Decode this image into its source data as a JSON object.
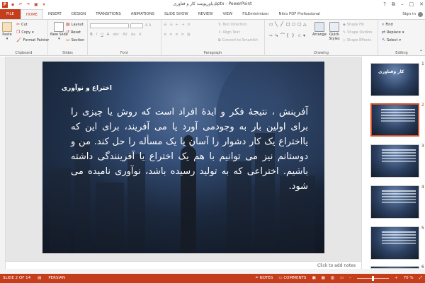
{
  "window": {
    "title": "پاورپوینت کار و فناوری.pptx - PowerPoint",
    "help": "?",
    "minimize": "–",
    "restore": "□",
    "close": "✕",
    "sign_in": "Sign in"
  },
  "tabs": [
    "FILE",
    "HOME",
    "INSERT",
    "DESIGN",
    "TRANSITIONS",
    "ANIMATIONS",
    "SLIDE SHOW",
    "REVIEW",
    "VIEW",
    "FILEminimizer",
    "Nitro PDF Professional"
  ],
  "active_tab": "HOME",
  "ribbon": {
    "clipboard": {
      "label": "Clipboard",
      "paste": "Paste",
      "cut": "Cut",
      "copy": "Copy",
      "format_painter": "Format Painter"
    },
    "slides": {
      "label": "Slides",
      "new_slide": "New Slide",
      "layout": "Layout",
      "reset": "Reset",
      "section": "Section"
    },
    "font": {
      "label": "Font",
      "font_name": "",
      "font_size": ""
    },
    "paragraph": {
      "label": "Paragraph",
      "text_direction": "Text Direction",
      "align_text": "Align Text",
      "convert_smartart": "Convert to SmartArt"
    },
    "drawing": {
      "label": "Drawing",
      "arrange": "Arrange",
      "quick_styles": "Quick Styles",
      "shape_fill": "Shape Fill",
      "shape_outline": "Shape Outline",
      "shape_effects": "Shape Effects"
    },
    "editing": {
      "label": "Editing",
      "find": "Find",
      "replace": "Replace",
      "select": "Select"
    }
  },
  "slide": {
    "title": "اختراع و نوآوری",
    "body": "آفرینش ، نتیجهٔ فکر و ایدهٔ افراد است که روش یا چیزی را برای اولین بار به وجودمی آورد یا می آفریند، برای این که یااختراع یک کار دشوار را آسان یا یک مسأله  را حل کند. من و دوستانم نیز می توانیم با هم یک اختراع یا آفرینندگی داشته باشیم. اختراعی که به تولید رسیده باشد، نوآوری نامیده می شود."
  },
  "notes_placeholder": "Click to add notes",
  "thumbnails": [
    {
      "num": "1",
      "title": "کار وفناوری"
    },
    {
      "num": "2",
      "title": ""
    },
    {
      "num": "3",
      "title": ""
    },
    {
      "num": "4",
      "title": ""
    },
    {
      "num": "5",
      "title": ""
    },
    {
      "num": "6",
      "title": ""
    }
  ],
  "status": {
    "slide_of": "SLIDE 2 OF 14",
    "language": "PERSIAN",
    "notes": "NOTES",
    "comments": "COMMENTS",
    "zoom": "70 %",
    "zoom_out": "–",
    "zoom_in": "+"
  },
  "colors": {
    "accent": "#c43e1c",
    "selected_thumb": "#d2522d"
  }
}
